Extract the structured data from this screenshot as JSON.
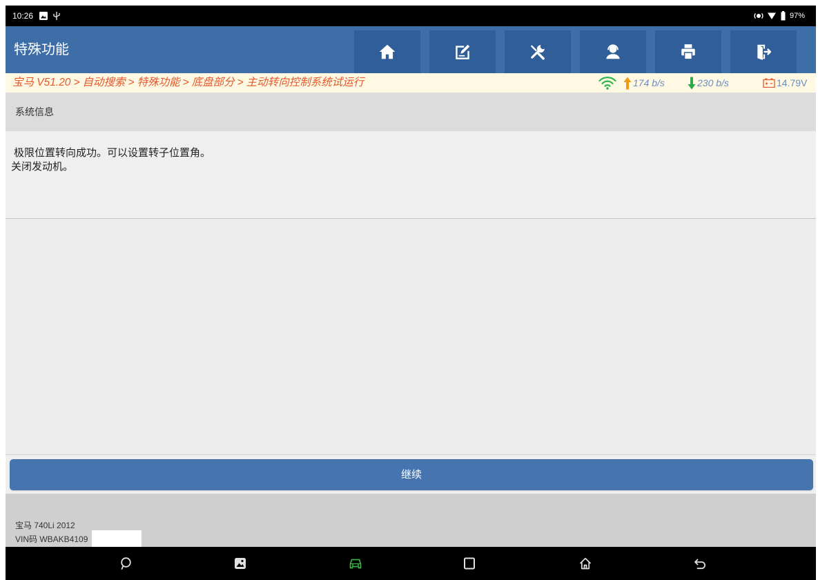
{
  "status_bar": {
    "time": "10:26",
    "battery_level": "97%",
    "left_icons": [
      "gallery-icon",
      "usb-icon"
    ],
    "right_icons": [
      "vibrate-icon",
      "wifi-signal-icon",
      "battery-icon"
    ]
  },
  "header": {
    "title": "特殊功能",
    "buttons": [
      {
        "icon": "home-icon"
      },
      {
        "icon": "edit-report-icon"
      },
      {
        "icon": "tools-icon"
      },
      {
        "icon": "support-agent-icon"
      },
      {
        "icon": "printer-icon"
      },
      {
        "icon": "exit-icon"
      }
    ]
  },
  "breadcrumb": {
    "items": [
      "宝马 V51.20",
      "自动搜索",
      "特殊功能",
      "底盘部分",
      "主动转向控制系统试运行"
    ],
    "separator": ">",
    "upload_speed": "174 b/s",
    "download_speed": "230 b/s",
    "voltage": "14.79V",
    "icons": [
      "wifi-icon",
      "upload-arrow-icon",
      "download-arrow-icon",
      "battery-voltage-icon"
    ]
  },
  "section": {
    "title": "系统信息"
  },
  "message": {
    "lines": [
      "极限位置转向成功。可以设置转子位置角。",
      "关闭发动机。"
    ]
  },
  "actions": {
    "continue_label": "继续"
  },
  "vehicle_info": {
    "model": "宝马 740Li 2012",
    "vin": "VIN码 WBAKB4109"
  },
  "nav_bar": {
    "icons": [
      "feedback-icon",
      "screenshot-icon",
      "vci-car-icon",
      "recent-apps-icon",
      "home-icon",
      "back-icon"
    ]
  },
  "colors": {
    "header_bg": "#3d6ea8",
    "header_button_bg": "#2f5e98",
    "breadcrumb_bg": "#fff8e3",
    "breadcrumb_text": "#e5582c",
    "speed_text": "#6a8cc0",
    "wifi": "#2fb84d",
    "upload_arrow": "#f39a12",
    "download_arrow": "#2fa84f",
    "primary_button": "#4574ae",
    "vci_icon": "#3cb043"
  }
}
